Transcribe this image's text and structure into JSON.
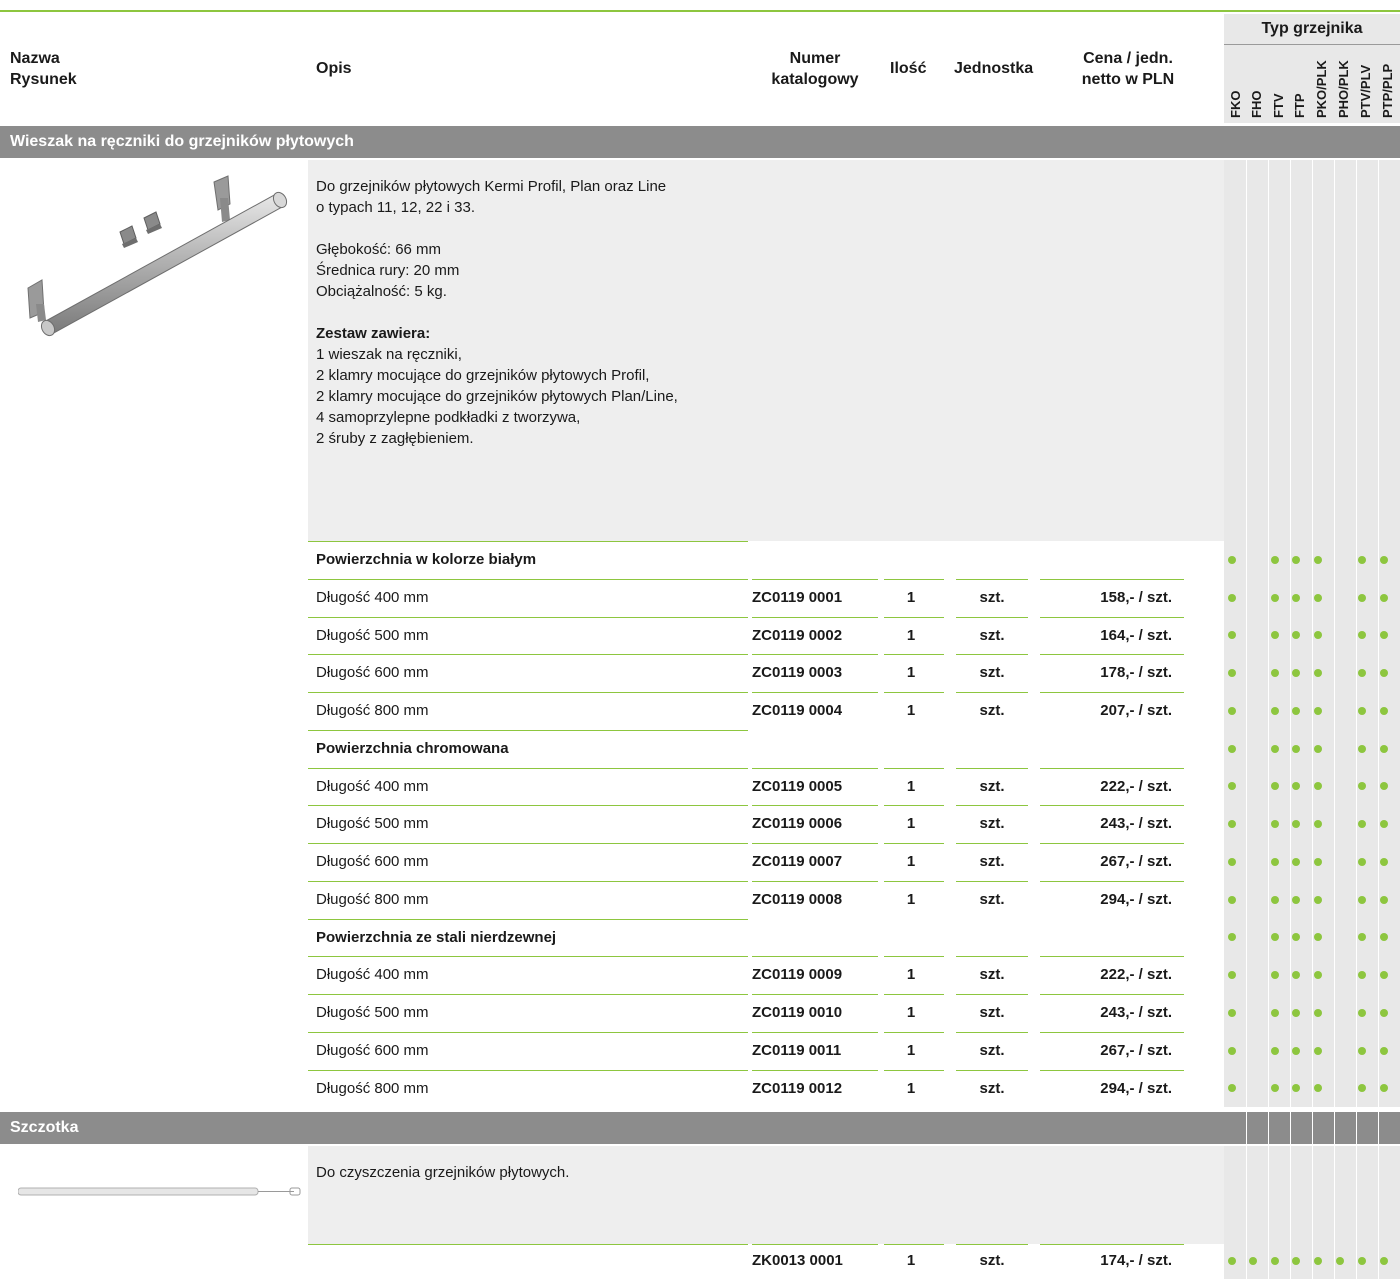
{
  "header": {
    "nazwa_line1": "Nazwa",
    "nazwa_line2": "Rysunek",
    "opis": "Opis",
    "numer_line1": "Numer",
    "numer_line2": "katalogowy",
    "ilosc": "Ilość",
    "jednostka": "Jednostka",
    "cena_line1": "Cena / jedn.",
    "cena_line2": "netto w PLN",
    "typ_title": "Typ grzejnika",
    "typ_columns": [
      "FKO",
      "FHO",
      "FTV",
      "FTP",
      "PKO/PLK",
      "PHO/PLK",
      "PTV/PLV",
      "PTP/PLP"
    ]
  },
  "section1": {
    "title": "Wieszak na ręczniki do grzejników płytowych",
    "image_icon": "towel-rail-image",
    "desc_lines": [
      "Do grzejników płytowych Kermi Profil, Plan oraz Line",
      "o typach 11, 12, 22 i 33.",
      "",
      "Głębokość: 66 mm",
      "Średnica rury: 20 mm",
      "Obciążalność: 5 kg.",
      ""
    ],
    "set_title": "Zestaw zawiera:",
    "set_lines": [
      "1 wieszak na ręczniki,",
      "2 klamry mocujące do grzejników płytowych Profil,",
      "2 klamry mocujące do grzejników płytowych Plan/Line,",
      "4 samoprzylepne podkładki z tworzywa,",
      "2 śruby z zagłębieniem."
    ],
    "groups": [
      {
        "title": "Powierzchnia w kolorze białym",
        "rows": [
          {
            "desc": "Długość 400 mm",
            "numer": "ZC0119 0001",
            "ilosc": "1",
            "jedn": "szt.",
            "cena": "158,- / szt."
          },
          {
            "desc": "Długość 500 mm",
            "numer": "ZC0119 0002",
            "ilosc": "1",
            "jedn": "szt.",
            "cena": "164,- / szt."
          },
          {
            "desc": "Długość 600 mm",
            "numer": "ZC0119 0003",
            "ilosc": "1",
            "jedn": "szt.",
            "cena": "178,- / szt."
          },
          {
            "desc": "Długość 800 mm",
            "numer": "ZC0119 0004",
            "ilosc": "1",
            "jedn": "szt.",
            "cena": "207,- / szt."
          }
        ]
      },
      {
        "title": "Powierzchnia chromowana",
        "rows": [
          {
            "desc": "Długość 400 mm",
            "numer": "ZC0119 0005",
            "ilosc": "1",
            "jedn": "szt.",
            "cena": "222,- / szt."
          },
          {
            "desc": "Długość 500 mm",
            "numer": "ZC0119 0006",
            "ilosc": "1",
            "jedn": "szt.",
            "cena": "243,- / szt."
          },
          {
            "desc": "Długość 600 mm",
            "numer": "ZC0119 0007",
            "ilosc": "1",
            "jedn": "szt.",
            "cena": "267,- / szt."
          },
          {
            "desc": "Długość 800 mm",
            "numer": "ZC0119 0008",
            "ilosc": "1",
            "jedn": "szt.",
            "cena": "294,- / szt."
          }
        ]
      },
      {
        "title": "Powierzchnia ze stali nierdzewnej",
        "rows": [
          {
            "desc": "Długość 400 mm",
            "numer": "ZC0119 0009",
            "ilosc": "1",
            "jedn": "szt.",
            "cena": "222,- / szt."
          },
          {
            "desc": "Długość 500 mm",
            "numer": "ZC0119 0010",
            "ilosc": "1",
            "jedn": "szt.",
            "cena": "243,- / szt."
          },
          {
            "desc": "Długość 600 mm",
            "numer": "ZC0119 0011",
            "ilosc": "1",
            "jedn": "szt.",
            "cena": "267,- / szt."
          },
          {
            "desc": "Długość 800 mm",
            "numer": "ZC0119 0012",
            "ilosc": "1",
            "jedn": "szt.",
            "cena": "294,- / szt."
          }
        ]
      }
    ],
    "compatibility": [
      true,
      false,
      true,
      true,
      true,
      false,
      true,
      true
    ]
  },
  "section2": {
    "title": "Szczotka",
    "image_icon": "brush-image",
    "desc": "Do czyszczenia grzejników płytowych.",
    "row": {
      "numer": "ZK0013 0001",
      "ilosc": "1",
      "jedn": "szt.",
      "cena": "174,- / szt."
    },
    "compatibility": [
      true,
      true,
      true,
      true,
      true,
      true,
      true,
      true
    ]
  },
  "colors": {
    "accent_green": "#8dc63f",
    "section_bar": "#8c8c8c",
    "desc_bg": "#eeeeee"
  }
}
